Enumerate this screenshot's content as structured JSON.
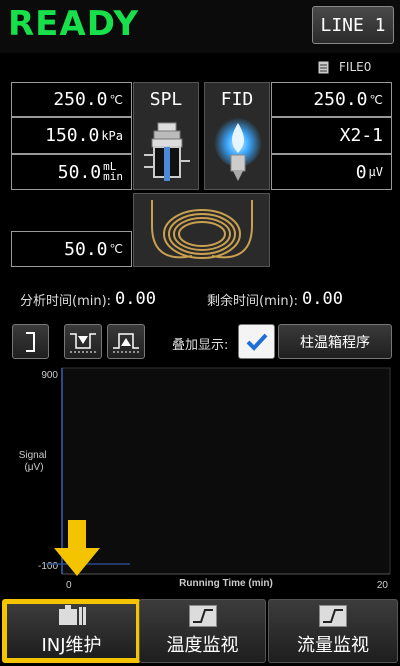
{
  "header": {
    "status": "READY",
    "line_button": "LINE 1"
  },
  "file": {
    "label": "FILE0",
    "icon": "file-icon"
  },
  "spl": {
    "title": "SPL"
  },
  "fid": {
    "title": "FID"
  },
  "params_left": [
    {
      "value": "250.0",
      "unit": "℃"
    },
    {
      "value": "150.0",
      "unit": "kPa"
    },
    {
      "value": "50.0",
      "unit_top": "mL",
      "unit_bottom": "min"
    }
  ],
  "params_right": [
    {
      "value": "250.0",
      "unit": "℃"
    },
    {
      "value": "X2-1",
      "unit": ""
    },
    {
      "value": "0",
      "unit": "μV"
    }
  ],
  "column_temp": {
    "value": "50.0",
    "unit": "℃"
  },
  "analysis_time": {
    "label": "分析时间(min):",
    "value": "0.00"
  },
  "remaining_time": {
    "label": "剩余时间(min):",
    "value": "0.00"
  },
  "overlay": {
    "label": "叠加显示:",
    "checked": true
  },
  "oven_program_button": "柱温箱程序",
  "chart_data": {
    "type": "line",
    "ylabel": "Signal\n(μV)",
    "xlabel": "Running Time (min)",
    "xlim": [
      0,
      20
    ],
    "ylim": [
      -100,
      900
    ],
    "y_ticks": [
      "900",
      "-100"
    ],
    "x_ticks": [
      "0",
      "20"
    ],
    "series": [
      {
        "values": []
      }
    ]
  },
  "nav": [
    {
      "label": "INJ维护",
      "icon": "injector-tools-icon",
      "highlighted": true
    },
    {
      "label": "温度监视",
      "icon": "step-graph-icon",
      "highlighted": false
    },
    {
      "label": "流量监视",
      "icon": "step-graph-icon",
      "highlighted": false
    }
  ],
  "colors": {
    "ready": "#18e04a",
    "highlight": "#f5c400",
    "flame": "#4ab8ff",
    "coil": "#c8a050"
  }
}
